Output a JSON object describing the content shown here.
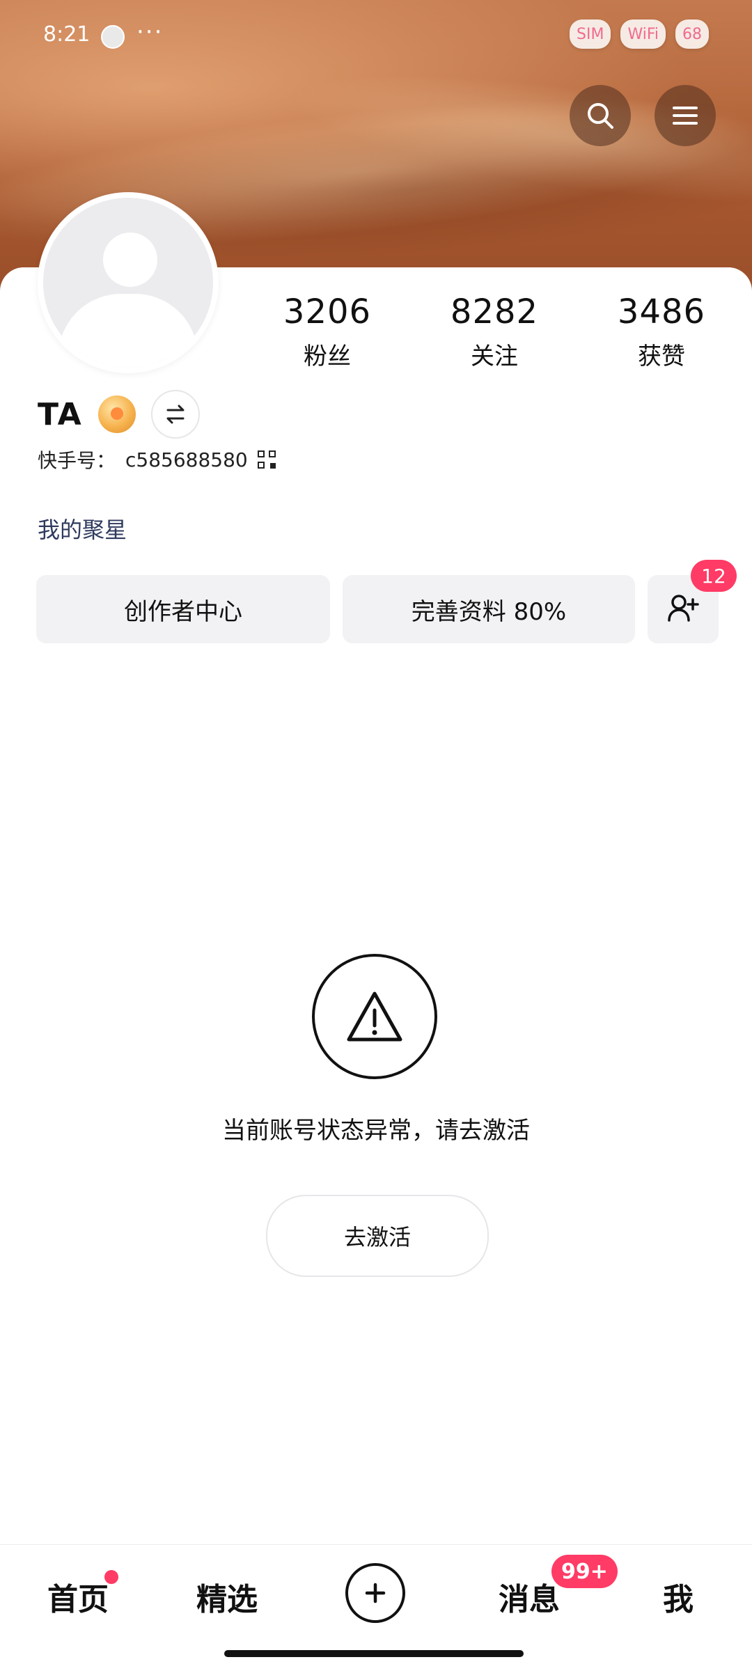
{
  "status_bar": {
    "time": "8:21",
    "dots": "···",
    "chips": [
      "SIM",
      "WiFi",
      "68"
    ]
  },
  "profile": {
    "username": "TA",
    "kuaishou_id_label": "快手号：",
    "kuaishou_id_value": "c585688580",
    "my_juxing": "我的聚星",
    "stats": [
      {
        "value": "3206",
        "label": "粉丝"
      },
      {
        "value": "8282",
        "label": "关注"
      },
      {
        "value": "3486",
        "label": "获赞"
      }
    ]
  },
  "actions": {
    "creator_center": "创作者中心",
    "complete_profile": "完善资料 80%",
    "friend_requests_badge": "12"
  },
  "notice": {
    "message": "当前账号状态异常，请去激活",
    "activate_label": "去激活"
  },
  "bottom_nav": {
    "home": "首页",
    "featured": "精选",
    "messages": "消息",
    "messages_badge": "99+",
    "me": "我"
  },
  "colors": {
    "accent_red": "#ff3b66",
    "link_blue": "#2f3a5e"
  },
  "icons": {
    "search": "search-icon",
    "menu": "menu-icon",
    "warning": "warning-icon",
    "add_friend": "add-friend-icon",
    "switch": "switch-account-icon",
    "plus": "plus-icon",
    "qr": "qr-code-icon"
  }
}
